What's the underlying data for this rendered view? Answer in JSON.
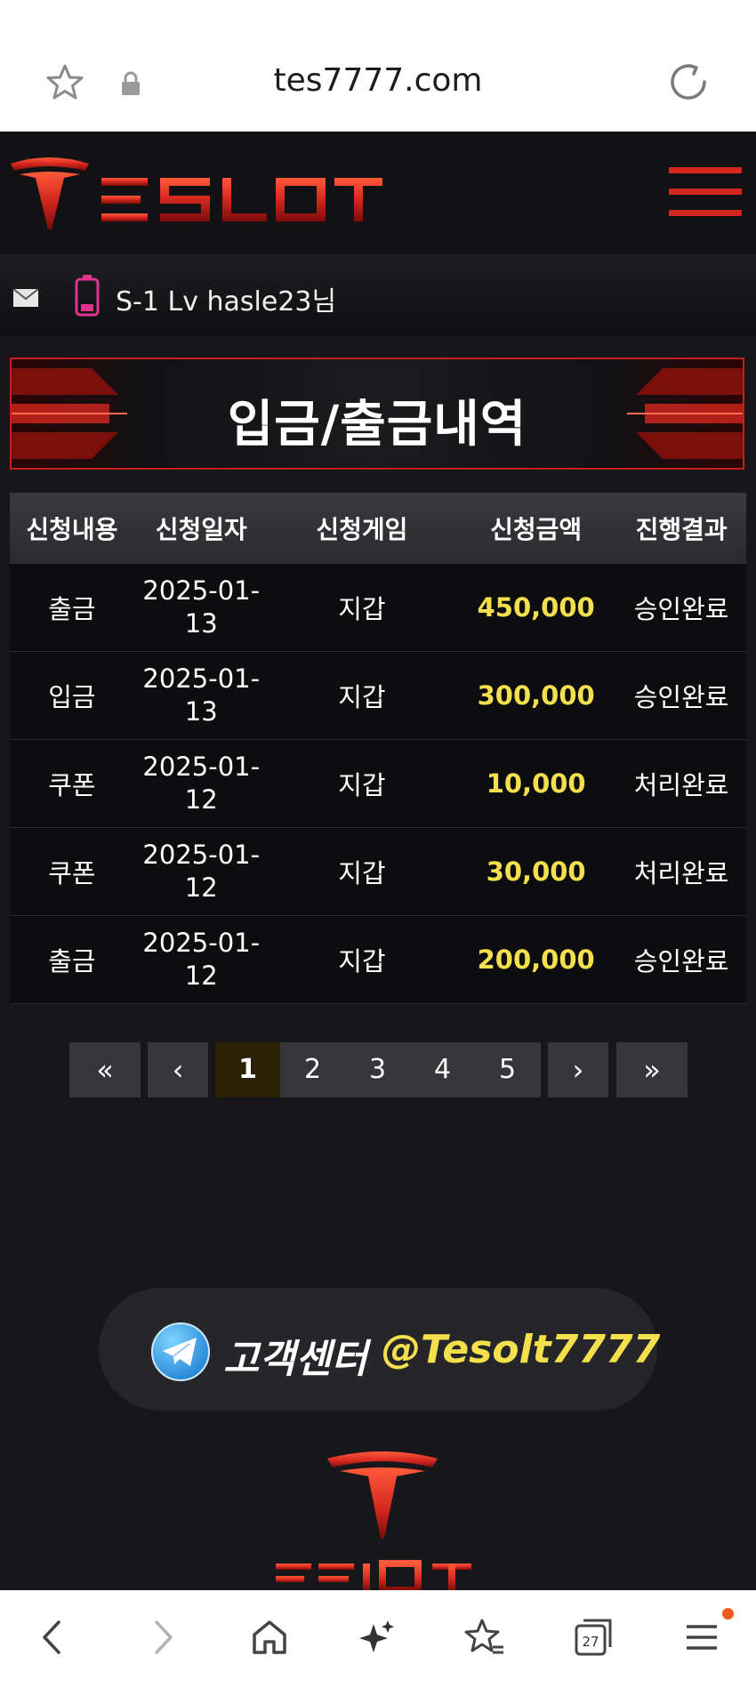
{
  "browser": {
    "url": "tes7777.com",
    "tabs_count": "27"
  },
  "header": {
    "logo_text": "TESLOT"
  },
  "user": {
    "label": "S-1 Lv hasle23님"
  },
  "page_title": "입금/출금내역",
  "table": {
    "headers": [
      "신청내용",
      "신청일자",
      "신청게임",
      "신청금액",
      "진행결과"
    ],
    "rows": [
      {
        "type": "출금",
        "date": "2025-01-13",
        "game": "지갑",
        "amount": "450,000",
        "result": "승인완료"
      },
      {
        "type": "입금",
        "date": "2025-01-13",
        "game": "지갑",
        "amount": "300,000",
        "result": "승인완료"
      },
      {
        "type": "쿠폰",
        "date": "2025-01-12",
        "game": "지갑",
        "amount": "10,000",
        "result": "처리완료"
      },
      {
        "type": "쿠폰",
        "date": "2025-01-12",
        "game": "지갑",
        "amount": "30,000",
        "result": "처리완료"
      },
      {
        "type": "출금",
        "date": "2025-01-12",
        "game": "지갑",
        "amount": "200,000",
        "result": "승인완료"
      }
    ]
  },
  "pagination": {
    "first": "«",
    "prev": "‹",
    "pages": [
      "1",
      "2",
      "3",
      "4",
      "5"
    ],
    "current": "1",
    "next": "›",
    "last": "»"
  },
  "support": {
    "label": "고객센터",
    "handle": "@Tesolt7777"
  },
  "colors": {
    "accent_red": "#d4261e",
    "amount_yellow": "#f4e04d",
    "background": "#17161a"
  }
}
